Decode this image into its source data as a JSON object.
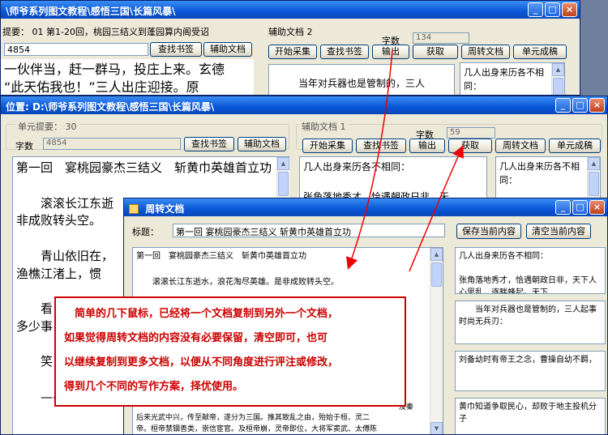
{
  "back_window": {
    "title": "\\师爷系列图文教程\\感悟三国\\长篇风暴\\",
    "summary": "提要： 01 第1-20回，桃园三结义到蓬园算内阁受诏",
    "count_value": "4854",
    "buttons": [
      "查找书签",
      "辅助文档"
    ],
    "aux_label": "辅助文档 2",
    "aux_count_label": "字数",
    "aux_count": "134",
    "aux_buttons": [
      "开始采集",
      "查找书签",
      "输出",
      "获取",
      "周转文档",
      "单元成稿"
    ],
    "main_text": "一伙伴当，赶一群马，投庄上来。玄德\n“此天佑我也！”三人出庄迎接。原",
    "aux_text": "当年对兵器也是管制的，三人",
    "side_text": "几人出身来历各不相同："
  },
  "mid_window": {
    "title": "位置: D:\\师爷系列图文教程\\感悟三国\\长篇风暴\\",
    "summary_label": "单元提要： 30",
    "count_label": "字数",
    "count_value": "4854",
    "buttons": [
      "查找书签",
      "辅助文档"
    ],
    "aux_label": "辅助文档 1",
    "aux_count_label": "字数",
    "aux_count": "59",
    "aux_buttons": [
      "开始采集",
      "查找书签",
      "输出",
      "获取",
      "周转文档",
      "单元成稿"
    ],
    "main_text": "第一回　宴桃园豪杰三结义　斩黄巾英雄首立功\n\n　　滚滚长江东逝\n非成败转头空。\n\n　　青山依旧在，\n渔樵江渚上，惯\n\n　　看\n多少事\n\n　　笑\n\n　　——调寄《临",
    "aux_text": "几人出身来历各不相同：\n\n张角落地秀才，恰遇朝政日非，天",
    "side_text": "几人出身来历各不相同："
  },
  "front_window": {
    "title": "周转文档",
    "title_label": "标题：",
    "title_value": "第一回  宴桃园豪杰三结义  斩黄巾英雄首立功",
    "save_button": "保存当前内容",
    "clear_button": "清空当前内容",
    "main_text": "第一回　宴桃园豪杰三结义　斩黄巾英雄首立功\n\n　　滚滚长江东逝水，浪花淘尽英雄。是非成败转头空。",
    "bottom_text": "　　　　　　　　　　　　　　　　　　　　　　　　　　　　　　　　　　　　及秦\n后来光武中兴，传至献帝，遂分为三国。推其致乱之由，殆始于桓、灵二\n帝。桓帝禁锢善类，崇信宦官。及桓帝崩，灵帝即位，大将军窦武、太傅陈",
    "side_texts": [
      "几人出身来历各不相同：\n\n张角落地秀才，恰遇朝政日非，天下人心思乱，逐畔蜂起。天下",
      "　　当年对兵器也是管制的，三人起事时尚无兵刃：",
      "刘备幼时有帝王之念，曹操自幼不羁，",
      "黄巾知道争取民心，却败于地主投机分子"
    ]
  },
  "annotation": {
    "lines": [
      "　简单的几下鼠标，已经将一个文档复制到另外一个文档，",
      "如果觉得周转文档的内容没有必要保留，清空即可，也可",
      "以继续复制到更多文档，以便从不同角度进行评注或修改，",
      "得到几个不同的写作方案，择优使用。"
    ],
    "color": "#cc0000"
  },
  "window_controls": {
    "minimize": "_",
    "maximize": "□",
    "close": "×"
  }
}
